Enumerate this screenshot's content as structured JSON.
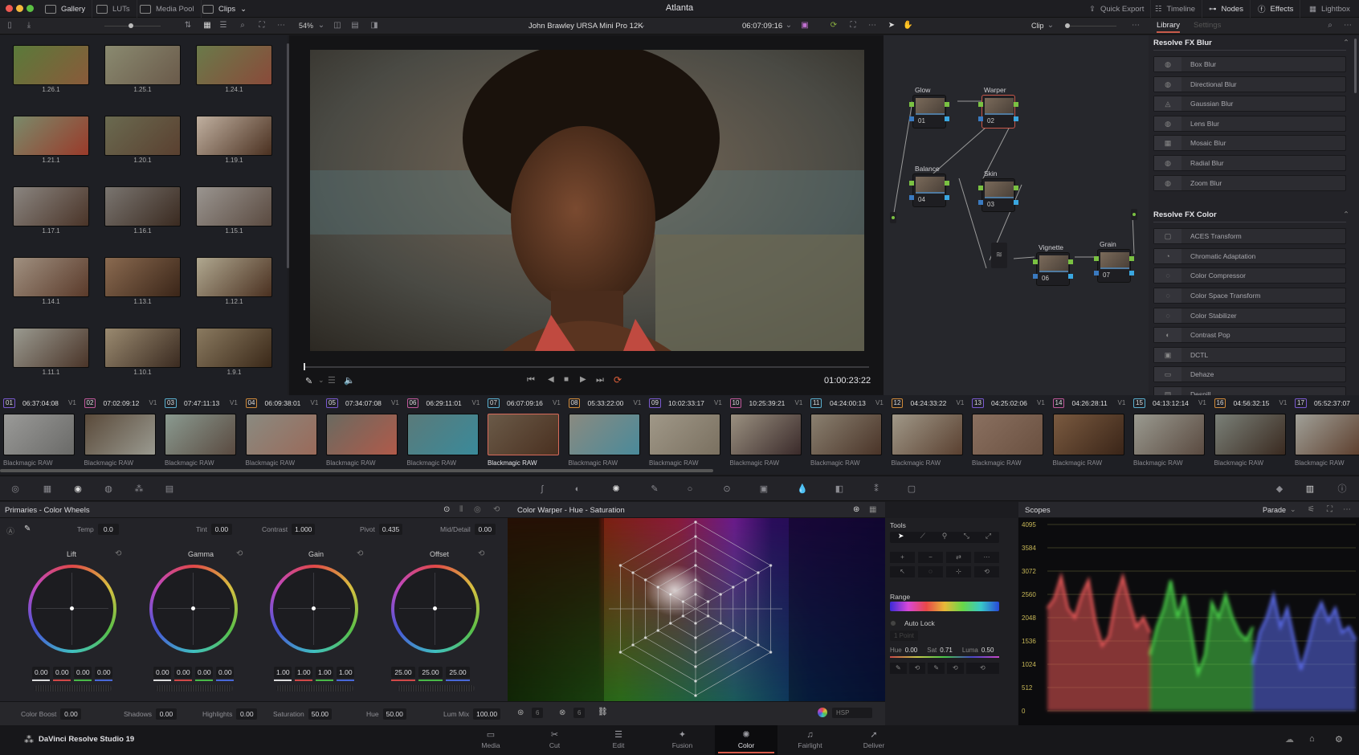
{
  "app": {
    "title": "Atlanta",
    "product": "DaVinci Resolve Studio 19"
  },
  "top_tabs_left": [
    {
      "label": "Gallery",
      "icon": "gallery-icon",
      "active": true
    },
    {
      "label": "LUTs",
      "icon": "luts-icon",
      "active": false
    },
    {
      "label": "Media Pool",
      "icon": "media-pool-icon",
      "active": false
    },
    {
      "label": "Clips",
      "icon": "clips-icon",
      "active": true,
      "dropdown": true
    }
  ],
  "top_tabs_right": [
    {
      "label": "Quick Export",
      "icon": "export-icon",
      "active": false
    },
    {
      "label": "Timeline",
      "icon": "timeline-icon",
      "active": false
    },
    {
      "label": "Nodes",
      "icon": "nodes-icon",
      "active": true
    },
    {
      "label": "Effects",
      "icon": "effects-icon",
      "active": true
    },
    {
      "label": "Lightbox",
      "icon": "lightbox-icon",
      "active": false
    }
  ],
  "viewer_toolbar": {
    "zoom": "54%",
    "timeline_name": "John Brawley URSA Mini Pro 12K",
    "timecode": "06:07:09:16",
    "node_mode": "Clip"
  },
  "effects_tabs": {
    "library": "Library",
    "settings": "Settings"
  },
  "gallery": {
    "stills": [
      {
        "label": "1.26.1",
        "colors": [
          "#5a7a3a",
          "#8a5a3a"
        ]
      },
      {
        "label": "1.25.1",
        "colors": [
          "#8a8a70",
          "#6a5a4a"
        ]
      },
      {
        "label": "1.24.1",
        "colors": [
          "#6a7a4a",
          "#8a4a3a"
        ]
      },
      {
        "label": "1.21.1",
        "colors": [
          "#7a8a6a",
          "#9a3a2a"
        ]
      },
      {
        "label": "1.20.1",
        "colors": [
          "#6a6a50",
          "#5a4030"
        ]
      },
      {
        "label": "1.19.1",
        "colors": [
          "#c0b0a0",
          "#4a3020"
        ]
      },
      {
        "label": "1.17.1",
        "colors": [
          "#8a8580",
          "#4a3428"
        ]
      },
      {
        "label": "1.16.1",
        "colors": [
          "#7a7570",
          "#3a2a20"
        ]
      },
      {
        "label": "1.15.1",
        "colors": [
          "#9a9590",
          "#5a4a40"
        ]
      },
      {
        "label": "1.14.1",
        "colors": [
          "#a09080",
          "#5a3a2a"
        ]
      },
      {
        "label": "1.13.1",
        "colors": [
          "#8a6a50",
          "#3a2518"
        ]
      },
      {
        "label": "1.12.1",
        "colors": [
          "#b0a890",
          "#4a3020"
        ]
      },
      {
        "label": "1.11.1",
        "colors": [
          "#9a9a90",
          "#4a3428"
        ]
      },
      {
        "label": "1.10.1",
        "colors": [
          "#9a8a70",
          "#3a2a20"
        ]
      },
      {
        "label": "1.9.1",
        "colors": [
          "#8a7a60",
          "#3a2818"
        ]
      }
    ]
  },
  "viewer": {
    "current_timecode": "01:00:23:22",
    "progress": 0.0
  },
  "nodes": [
    {
      "label": "Glow",
      "num": "01",
      "selected": false
    },
    {
      "label": "Warper",
      "num": "02",
      "selected": true
    },
    {
      "label": "Balance",
      "num": "04",
      "selected": false
    },
    {
      "label": "Skin",
      "num": "03",
      "selected": false
    },
    {
      "label": "Vignette",
      "num": "06",
      "selected": false
    },
    {
      "label": "Grain",
      "num": "07",
      "selected": false
    }
  ],
  "effects": {
    "groups": [
      {
        "title": "Resolve FX Blur",
        "items": [
          "Box Blur",
          "Directional Blur",
          "Gaussian Blur",
          "Lens Blur",
          "Mosaic Blur",
          "Radial Blur",
          "Zoom Blur"
        ]
      },
      {
        "title": "Resolve FX Color",
        "items": [
          "ACES Transform",
          "Chromatic Adaptation",
          "Color Compressor",
          "Color Space Transform",
          "Color Stabilizer",
          "Contrast Pop",
          "DCTL",
          "Dehaze",
          "Despill"
        ]
      }
    ]
  },
  "clips": [
    {
      "num": "01",
      "tc": "06:37:04:08",
      "track": "V1",
      "type": "Blackmagic RAW",
      "colors": [
        "#9a9a98",
        "#6a6a68"
      ]
    },
    {
      "num": "02",
      "tc": "07:02:09:12",
      "track": "V1",
      "type": "Blackmagic RAW",
      "colors": [
        "#5a4a3a",
        "#9a9a90"
      ]
    },
    {
      "num": "03",
      "tc": "07:47:11:13",
      "track": "V1",
      "type": "Blackmagic RAW",
      "colors": [
        "#8a9a90",
        "#5a4a40"
      ]
    },
    {
      "num": "04",
      "tc": "06:09:38:01",
      "track": "V1",
      "type": "Blackmagic RAW",
      "colors": [
        "#8a8a80",
        "#9a6a5a"
      ]
    },
    {
      "num": "05",
      "tc": "07:34:07:08",
      "track": "V1",
      "type": "Blackmagic RAW",
      "colors": [
        "#6a6a60",
        "#b05a4a"
      ]
    },
    {
      "num": "06",
      "tc": "06:29:11:01",
      "track": "V1",
      "type": "Blackmagic RAW",
      "colors": [
        "#5a7a7a",
        "#3a8a9a"
      ]
    },
    {
      "num": "07",
      "tc": "06:07:09:16",
      "track": "V1",
      "type": "Blackmagic RAW",
      "colors": [
        "#6a5a48",
        "#4a3020"
      ],
      "current": true
    },
    {
      "num": "08",
      "tc": "05:33:22:00",
      "track": "V1",
      "type": "Blackmagic RAW",
      "colors": [
        "#8a8a80",
        "#4a8a9a"
      ]
    },
    {
      "num": "09",
      "tc": "10:02:33:17",
      "track": "V1",
      "type": "Blackmagic RAW",
      "colors": [
        "#a09888",
        "#7a7060"
      ]
    },
    {
      "num": "10",
      "tc": "10:25:39:21",
      "track": "V1",
      "type": "Blackmagic RAW",
      "colors": [
        "#9a9080",
        "#3a2a2a"
      ]
    },
    {
      "num": "11",
      "tc": "04:24:00:13",
      "track": "V1",
      "type": "Blackmagic RAW",
      "colors": [
        "#8a8070",
        "#4a3428"
      ]
    },
    {
      "num": "12",
      "tc": "04:24:33:22",
      "track": "V1",
      "type": "Blackmagic RAW",
      "colors": [
        "#a09888",
        "#5a4030"
      ]
    },
    {
      "num": "13",
      "tc": "04:25:02:06",
      "track": "V1",
      "type": "Blackmagic RAW",
      "colors": [
        "#8a7060",
        "#6a5040"
      ]
    },
    {
      "num": "14",
      "tc": "04:26:28:11",
      "track": "V1",
      "type": "Blackmagic RAW",
      "colors": [
        "#7a5a40",
        "#3a2518"
      ]
    },
    {
      "num": "15",
      "tc": "04:13:12:14",
      "track": "V1",
      "type": "Blackmagic RAW",
      "colors": [
        "#9a9a90",
        "#5a4a40"
      ]
    },
    {
      "num": "16",
      "tc": "04:56:32:15",
      "track": "V1",
      "type": "Blackmagic RAW",
      "colors": [
        "#7a8078",
        "#3a2a20"
      ]
    },
    {
      "num": "17",
      "tc": "05:52:37:07",
      "track": "V1",
      "type": "Blackmagic RAW",
      "colors": [
        "#a0a098",
        "#5a3a28"
      ]
    }
  ],
  "primaries": {
    "title": "Primaries - Color Wheels",
    "params_top": [
      {
        "label": "Temp",
        "value": "0.0"
      },
      {
        "label": "Tint",
        "value": "0.00"
      },
      {
        "label": "Contrast",
        "value": "1.000"
      },
      {
        "label": "Pivot",
        "value": "0.435"
      },
      {
        "label": "Mid/Detail",
        "value": "0.00"
      }
    ],
    "wheels": [
      {
        "label": "Lift",
        "values": [
          "0.00",
          "0.00",
          "0.00",
          "0.00"
        ]
      },
      {
        "label": "Gamma",
        "values": [
          "0.00",
          "0.00",
          "0.00",
          "0.00"
        ]
      },
      {
        "label": "Gain",
        "values": [
          "1.00",
          "1.00",
          "1.00",
          "1.00"
        ]
      },
      {
        "label": "Offset",
        "values": [
          "25.00",
          "25.00",
          "25.00"
        ]
      }
    ],
    "params_bottom": [
      {
        "label": "Color Boost",
        "value": "0.00"
      },
      {
        "label": "Shadows",
        "value": "0.00"
      },
      {
        "label": "Highlights",
        "value": "0.00"
      },
      {
        "label": "Saturation",
        "value": "50.00"
      },
      {
        "label": "Hue",
        "value": "50.00"
      },
      {
        "label": "Lum Mix",
        "value": "100.00"
      }
    ]
  },
  "warper": {
    "title": "Color Warper - Hue - Saturation",
    "hue_res": "6",
    "sat_res": "6",
    "color_space": "HSP"
  },
  "tools": {
    "title": "Tools",
    "range_label": "Range",
    "auto_lock_label": "Auto Lock",
    "point_mode": "1 Point",
    "hue_label": "Hue",
    "hue_value": "0.00",
    "sat_label": "Sat",
    "sat_value": "0.71",
    "luma_label": "Luma",
    "luma_value": "0.50"
  },
  "scopes": {
    "title": "Scopes",
    "mode": "Parade",
    "axis_ticks": [
      "4095",
      "3584",
      "3072",
      "2560",
      "2048",
      "1536",
      "1024",
      "512",
      "0"
    ]
  },
  "pages": [
    {
      "label": "Media",
      "icon": "▭"
    },
    {
      "label": "Cut",
      "icon": "✂"
    },
    {
      "label": "Edit",
      "icon": "☰"
    },
    {
      "label": "Fusion",
      "icon": "✦"
    },
    {
      "label": "Color",
      "icon": "✺",
      "active": true
    },
    {
      "label": "Fairlight",
      "icon": "♫"
    },
    {
      "label": "Deliver",
      "icon": "➚"
    }
  ]
}
